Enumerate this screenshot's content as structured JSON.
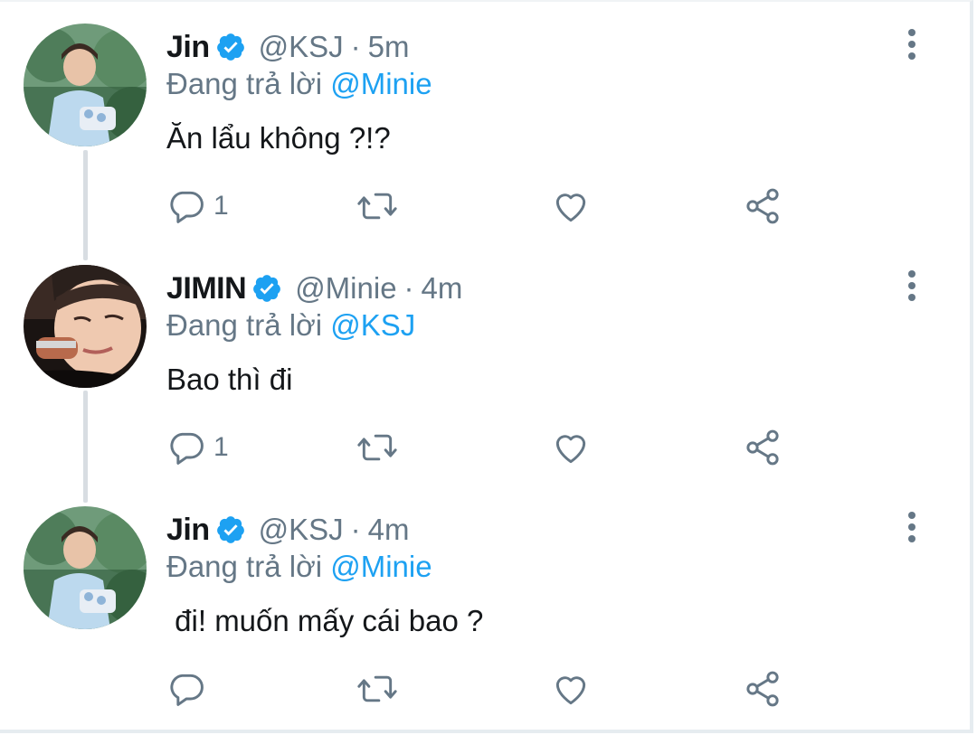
{
  "tweets": [
    {
      "name": "Jin",
      "handle": "@KSJ",
      "separator": "·",
      "time": "5m",
      "replying_prefix": "Đang trả lời",
      "replying_to": "@Minie",
      "text": "Ăn lẩu không ?!?",
      "reply_count": "1",
      "avatar": "jin-avatar"
    },
    {
      "name": "JIMIN",
      "handle": "@Minie",
      "separator": "·",
      "time": "4m",
      "replying_prefix": "Đang trả lời",
      "replying_to": "@KSJ",
      "text": "Bao thì đi",
      "reply_count": "1",
      "avatar": "jimin-avatar"
    },
    {
      "name": "Jin",
      "handle": "@KSJ",
      "separator": "·",
      "time": "4m",
      "replying_prefix": "Đang trả lời",
      "replying_to": "@Minie",
      "text": " đi! muốn mấy cái bao ?",
      "reply_count": "",
      "avatar": "jin-avatar"
    }
  ],
  "icons": {
    "reply": "reply-icon",
    "retweet": "retweet-icon",
    "like": "heart-icon",
    "share": "share-icon",
    "verified": "verified-badge-icon",
    "more": "more-vertical-icon"
  },
  "colors": {
    "accent": "#1da1f2",
    "muted": "#657786",
    "text": "#14171a",
    "thread_line": "#d8dde2"
  }
}
